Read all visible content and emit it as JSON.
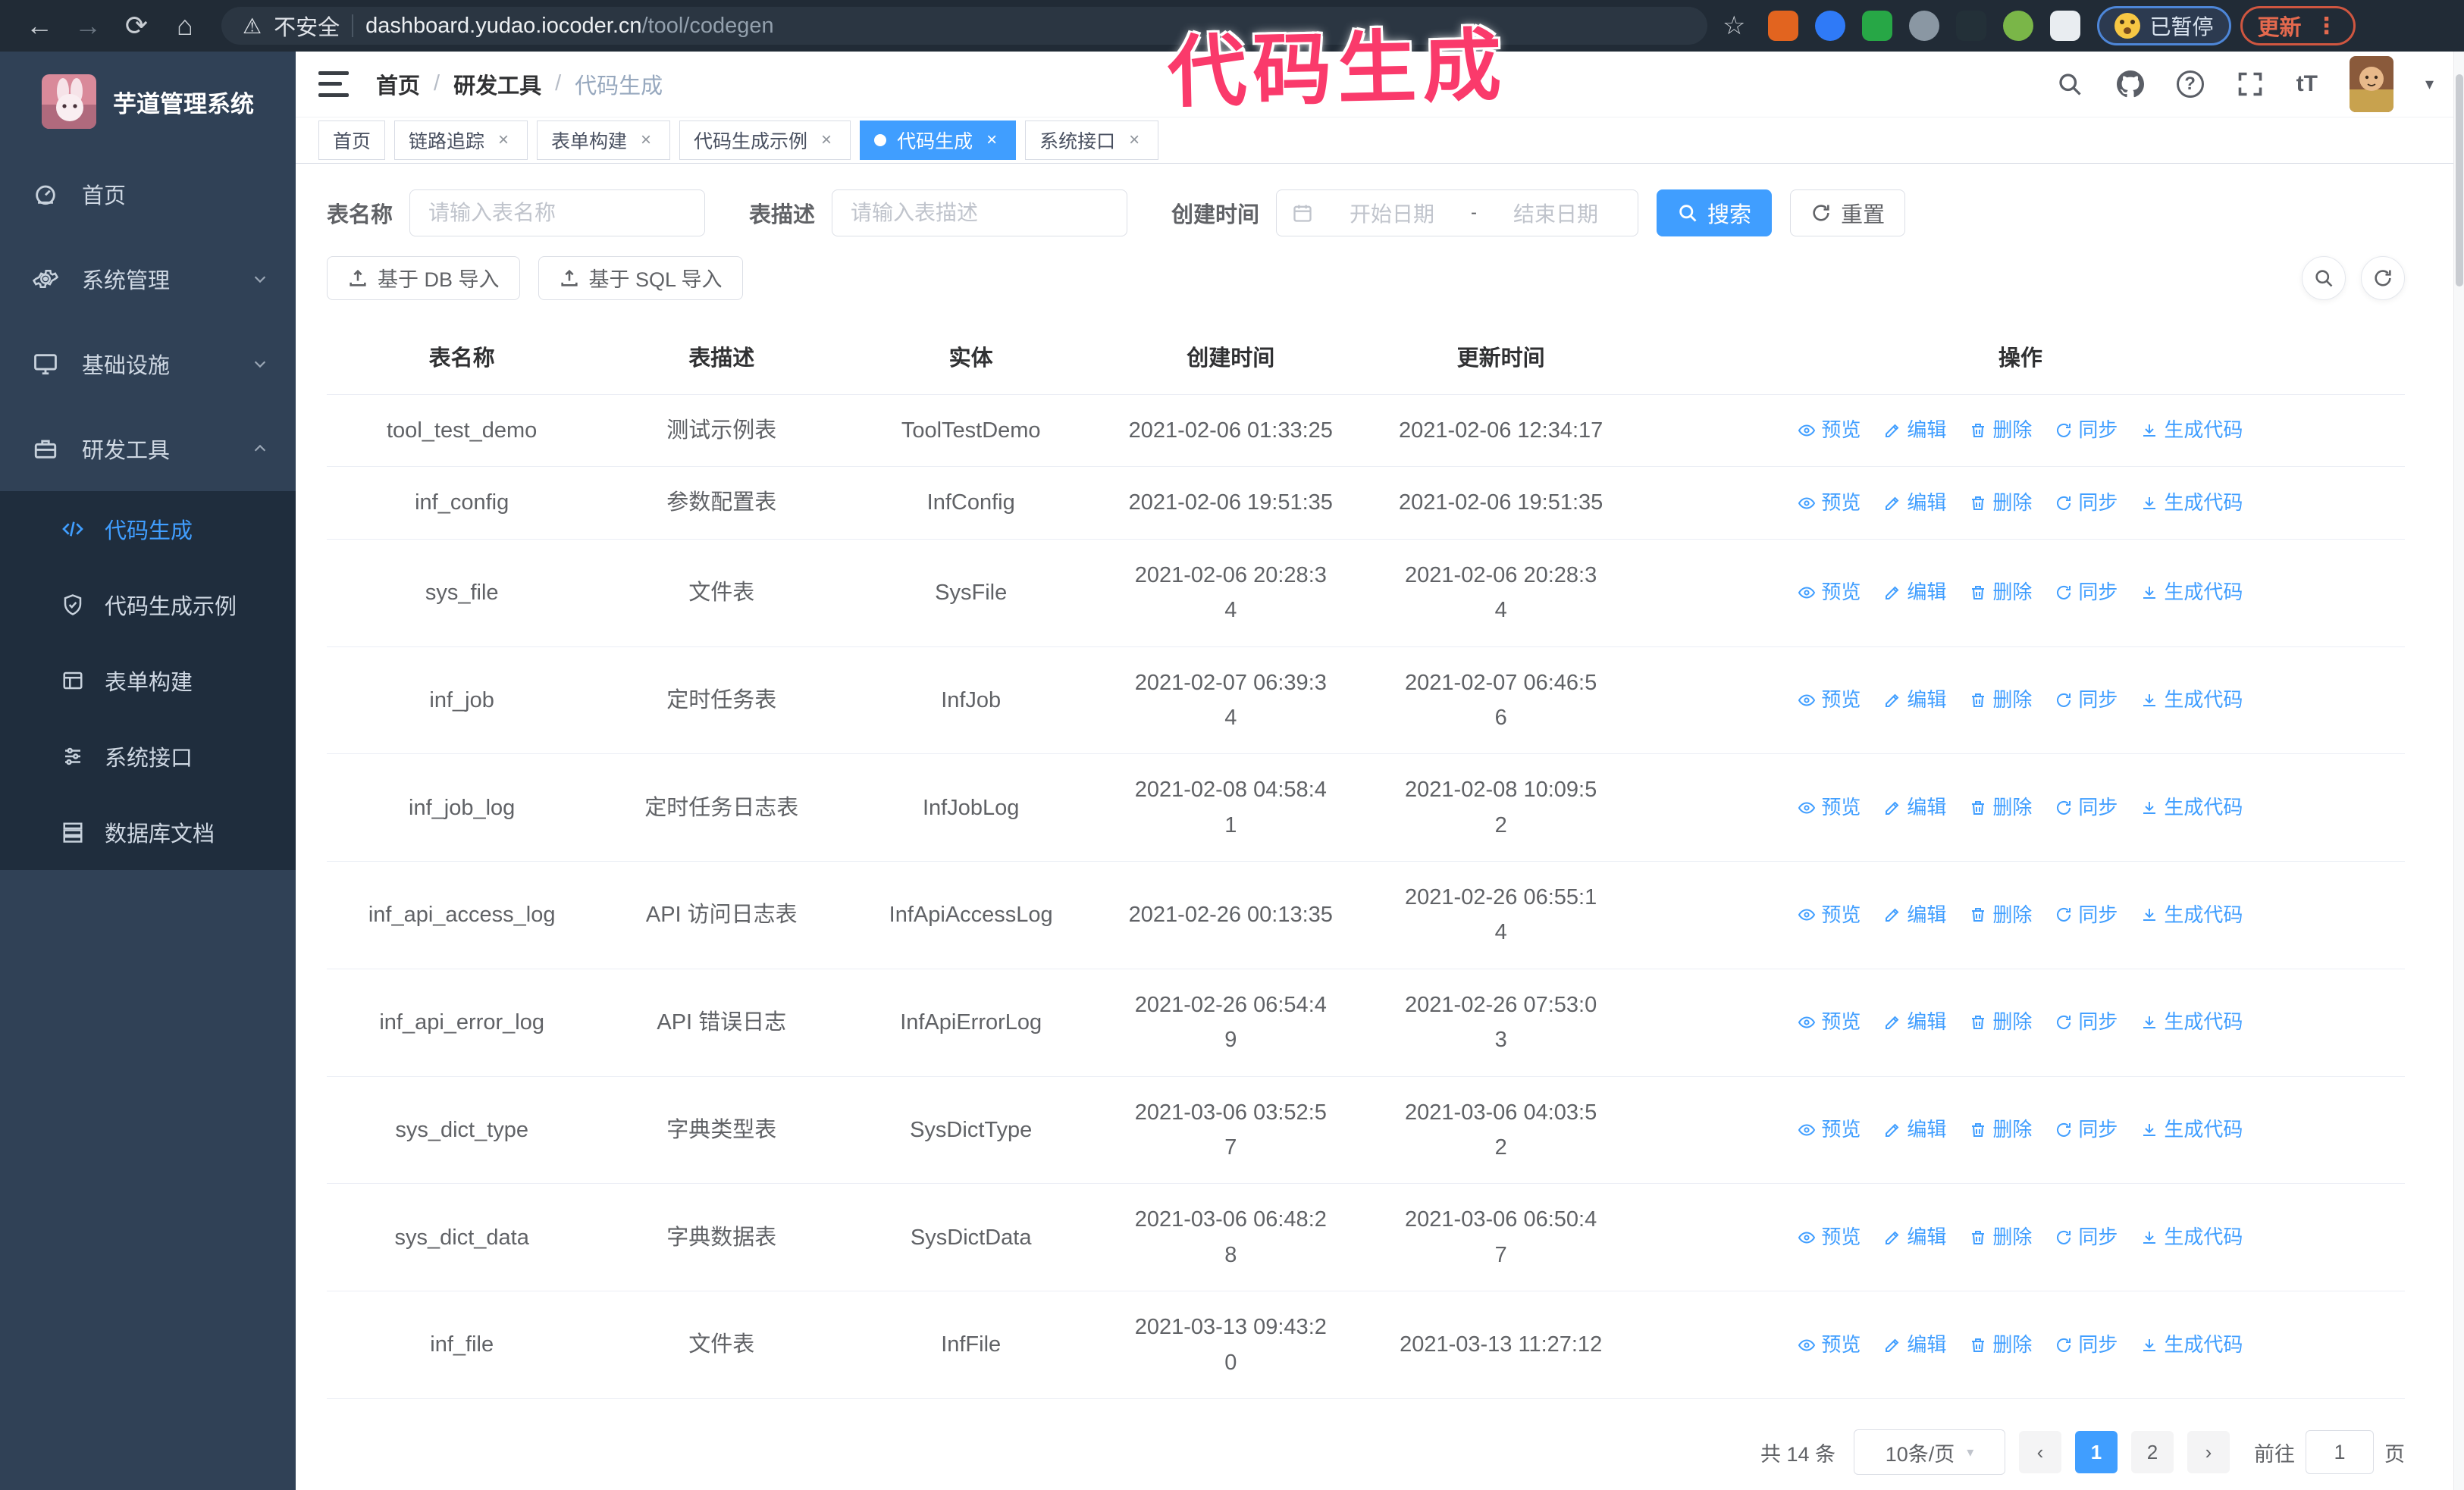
{
  "annotation": {
    "text": "代码生成"
  },
  "browser": {
    "not_secure": "不安全",
    "url_host": "dashboard.yudao.iocoder.cn",
    "url_path": "/tool/codegen",
    "paused_badge": "已暂停",
    "update_label": "更新",
    "extensions": [
      "#e2641f",
      "#2f7af7",
      "#27a746",
      "#8a97a3",
      "#233038",
      "#7ab648",
      "#e9edf1"
    ]
  },
  "sidebar": {
    "title": "芋道管理系统",
    "menu": [
      {
        "label": "首页",
        "icon": "dashboard-icon",
        "chevron": ""
      },
      {
        "label": "系统管理",
        "icon": "gear-icon",
        "chevron": "down"
      },
      {
        "label": "基础设施",
        "icon": "monitor-icon",
        "chevron": "down"
      },
      {
        "label": "研发工具",
        "icon": "toolbox-icon",
        "chevron": "up"
      }
    ],
    "submenu": [
      {
        "label": "代码生成",
        "icon": "code-icon",
        "active": true
      },
      {
        "label": "代码生成示例",
        "icon": "shield-check-icon",
        "active": false
      },
      {
        "label": "表单构建",
        "icon": "form-builder-icon",
        "active": false
      },
      {
        "label": "系统接口",
        "icon": "api-icon",
        "active": false
      },
      {
        "label": "数据库文档",
        "icon": "database-icon",
        "active": false
      }
    ]
  },
  "header": {
    "breadcrumb": [
      "首页",
      "研发工具",
      "代码生成"
    ]
  },
  "tabs": [
    {
      "label": "首页",
      "closable": false,
      "active": false
    },
    {
      "label": "链路追踪",
      "closable": true,
      "active": false
    },
    {
      "label": "表单构建",
      "closable": true,
      "active": false
    },
    {
      "label": "代码生成示例",
      "closable": true,
      "active": false
    },
    {
      "label": "代码生成",
      "closable": true,
      "active": true
    },
    {
      "label": "系统接口",
      "closable": true,
      "active": false
    }
  ],
  "filters": {
    "name_label": "表名称",
    "name_placeholder": "请输入表名称",
    "desc_label": "表描述",
    "desc_placeholder": "请输入表描述",
    "time_label": "创建时间",
    "start_placeholder": "开始日期",
    "separator": "-",
    "end_placeholder": "结束日期",
    "search_label": "搜索",
    "reset_label": "重置"
  },
  "toolbar": {
    "import_db": "基于 DB 导入",
    "import_sql": "基于 SQL 导入"
  },
  "table": {
    "columns": [
      "表名称",
      "表描述",
      "实体",
      "创建时间",
      "更新时间",
      "操作"
    ],
    "ops": [
      {
        "label": "预览",
        "icon": "eye-icon"
      },
      {
        "label": "编辑",
        "icon": "edit-icon"
      },
      {
        "label": "删除",
        "icon": "delete-icon"
      },
      {
        "label": "同步",
        "icon": "sync-icon"
      },
      {
        "label": "生成代码",
        "icon": "download-icon"
      }
    ],
    "rows": [
      {
        "name": "tool_test_demo",
        "desc": "测试示例表",
        "entity": "ToolTestDemo",
        "created": "2021-02-06 01:33:25",
        "updated": "2021-02-06 12:34:17"
      },
      {
        "name": "inf_config",
        "desc": "参数配置表",
        "entity": "InfConfig",
        "created": "2021-02-06 19:51:35",
        "updated": "2021-02-06 19:51:35"
      },
      {
        "name": "sys_file",
        "desc": "文件表",
        "entity": "SysFile",
        "created": "2021-02-06 20:28:3\n4",
        "updated": "2021-02-06 20:28:3\n4"
      },
      {
        "name": "inf_job",
        "desc": "定时任务表",
        "entity": "InfJob",
        "created": "2021-02-07 06:39:3\n4",
        "updated": "2021-02-07 06:46:5\n6"
      },
      {
        "name": "inf_job_log",
        "desc": "定时任务日志表",
        "entity": "InfJobLog",
        "created": "2021-02-08 04:58:4\n1",
        "updated": "2021-02-08 10:09:5\n2"
      },
      {
        "name": "inf_api_access_log",
        "desc": "API 访问日志表",
        "entity": "InfApiAccessLog",
        "created": "2021-02-26 00:13:35",
        "updated": "2021-02-26 06:55:1\n4"
      },
      {
        "name": "inf_api_error_log",
        "desc": "API 错误日志",
        "entity": "InfApiErrorLog",
        "created": "2021-02-26 06:54:4\n9",
        "updated": "2021-02-26 07:53:0\n3"
      },
      {
        "name": "sys_dict_type",
        "desc": "字典类型表",
        "entity": "SysDictType",
        "created": "2021-03-06 03:52:5\n7",
        "updated": "2021-03-06 04:03:5\n2"
      },
      {
        "name": "sys_dict_data",
        "desc": "字典数据表",
        "entity": "SysDictData",
        "created": "2021-03-06 06:48:2\n8",
        "updated": "2021-03-06 06:50:4\n7"
      },
      {
        "name": "inf_file",
        "desc": "文件表",
        "entity": "InfFile",
        "created": "2021-03-13 09:43:2\n0",
        "updated": "2021-03-13 11:27:12"
      }
    ]
  },
  "pagination": {
    "total": "共 14 条",
    "page_size": "10条/页",
    "pages": [
      "1",
      "2"
    ],
    "active_page": "1",
    "goto_label": "前往",
    "goto_value": "1",
    "goto_suffix": "页"
  },
  "colors": {
    "accent": "#409eff",
    "annotation": "#fa3a6b",
    "sidebar_bg": "#304156",
    "submenu_bg": "#1f2d3d"
  }
}
